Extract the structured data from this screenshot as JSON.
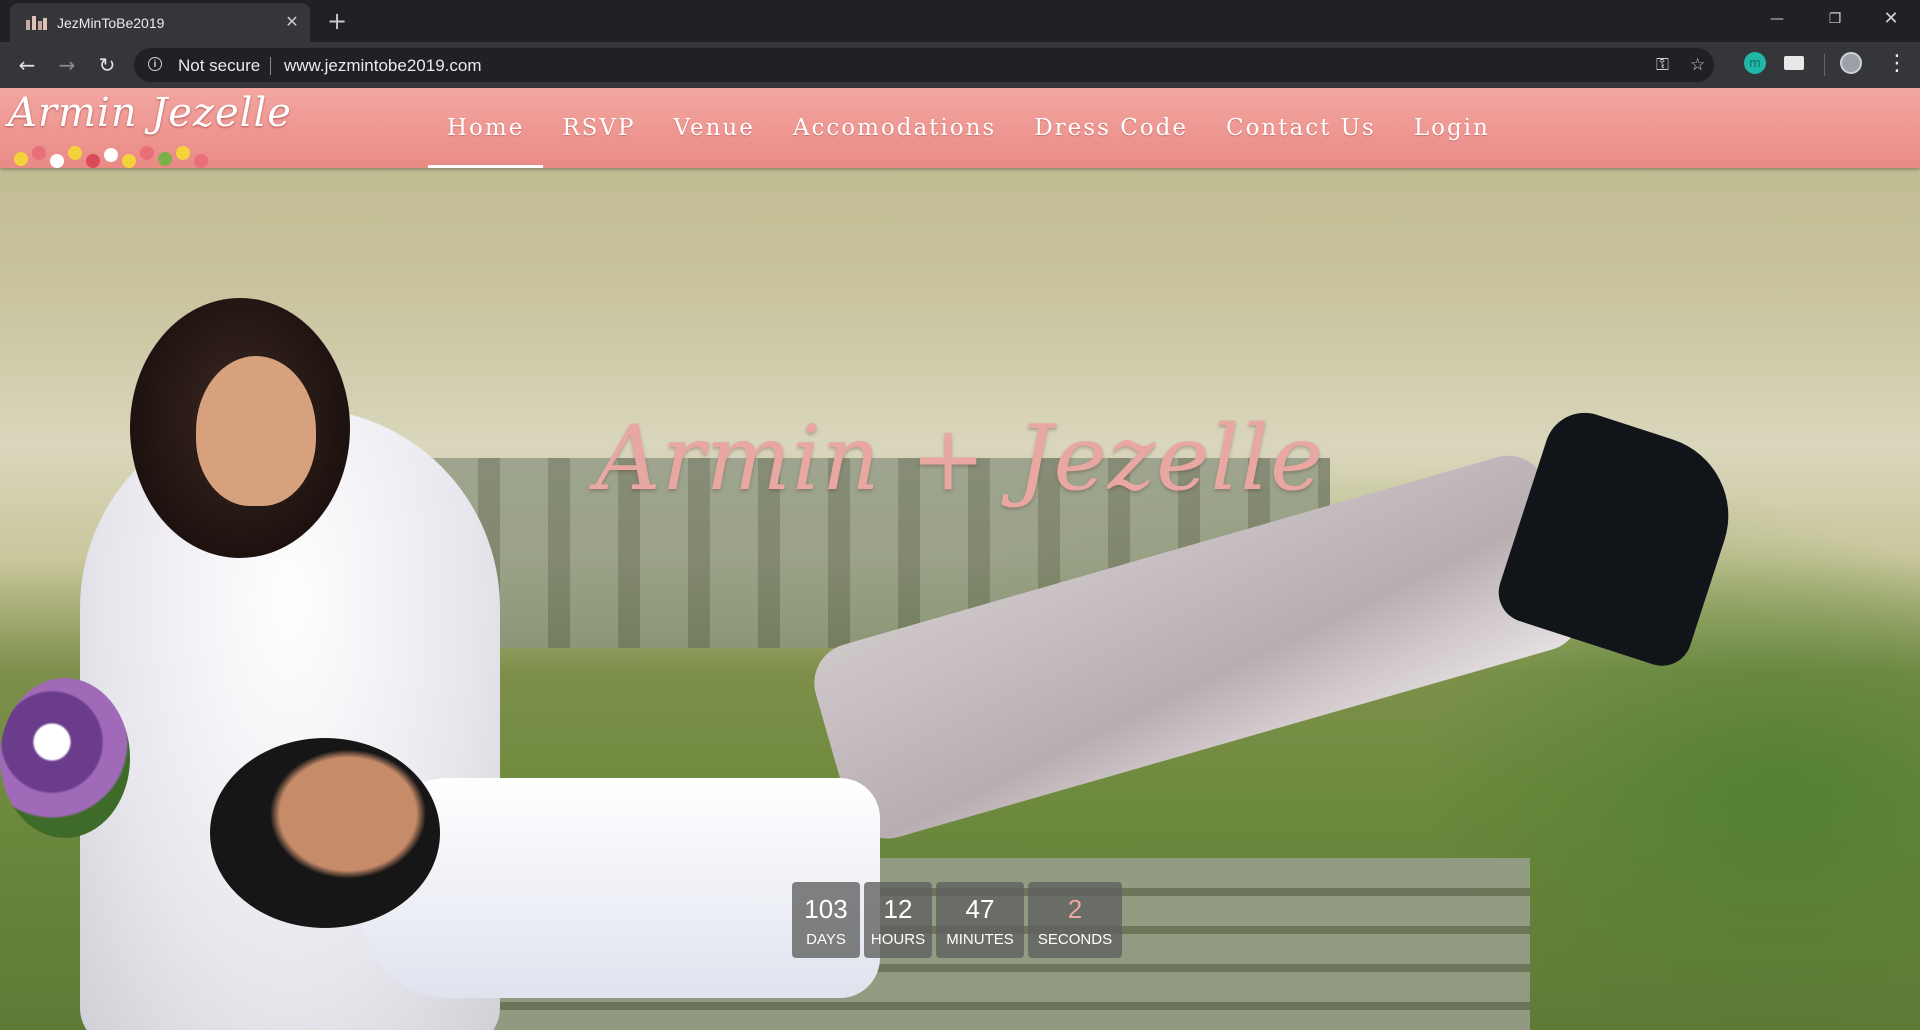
{
  "browser": {
    "tab": {
      "title": "JezMinToBe2019",
      "close_icon": "close-icon"
    },
    "new_tab_icon": "plus-icon",
    "window_controls": [
      "minimize-icon",
      "restore-icon",
      "close-icon"
    ],
    "security_label": "Not secure",
    "url": "www.jezmintobe2019.com",
    "toolbar_icons": [
      "key-icon",
      "star-icon",
      "extension-m-icon",
      "extension-card-icon",
      "profile-avatar",
      "menu-icon"
    ]
  },
  "site": {
    "logo_text": "Armin Jezelle",
    "nav": [
      "Home",
      "RSVP",
      "Venue",
      "Accomodations",
      "Dress Code",
      "Contact Us",
      "Login"
    ],
    "active_nav": "Home",
    "hero_title": "Armin + Jezelle",
    "countdown": {
      "days": "103",
      "days_label": "DAYS",
      "hours": "12",
      "hours_label": "HOURS",
      "minutes": "47",
      "minutes_label": "MINUTES",
      "seconds": "2",
      "seconds_label": "SECONDS"
    },
    "colors": {
      "header": "#ee9590",
      "accent": "#e8a7a0"
    }
  }
}
